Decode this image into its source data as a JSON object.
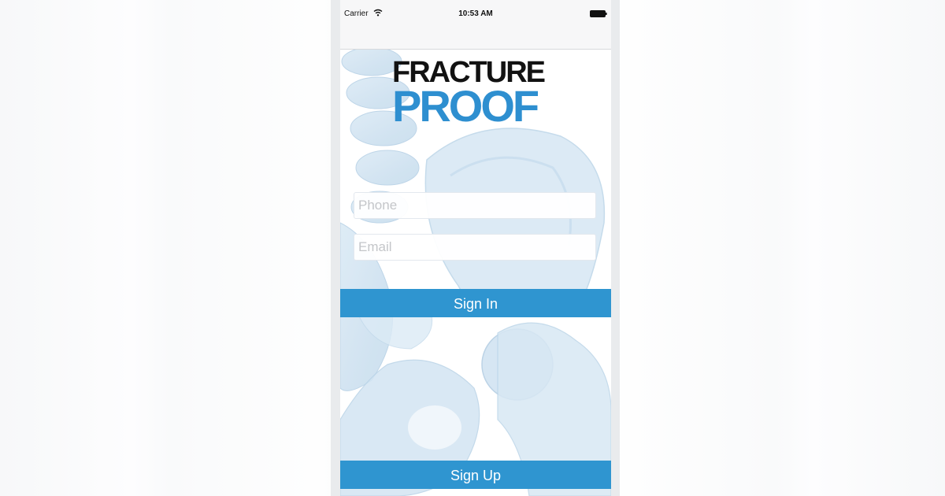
{
  "status_bar": {
    "carrier": "Carrier",
    "time": "10:53 AM",
    "wifi_icon": "wifi-icon",
    "battery_icon": "battery-icon"
  },
  "logo": {
    "line1": "FRACTURE",
    "line2": "PROOF",
    "line1_color": "#121212",
    "line2_color": "#2e8fd0"
  },
  "form": {
    "phone_placeholder": "Phone",
    "phone_value": "",
    "email_placeholder": "Email",
    "email_value": ""
  },
  "buttons": {
    "sign_in_label": "Sign In",
    "sign_up_label": "Sign Up"
  },
  "colors": {
    "accent": "#2f95d0",
    "background_art": "#cfe3f2"
  }
}
